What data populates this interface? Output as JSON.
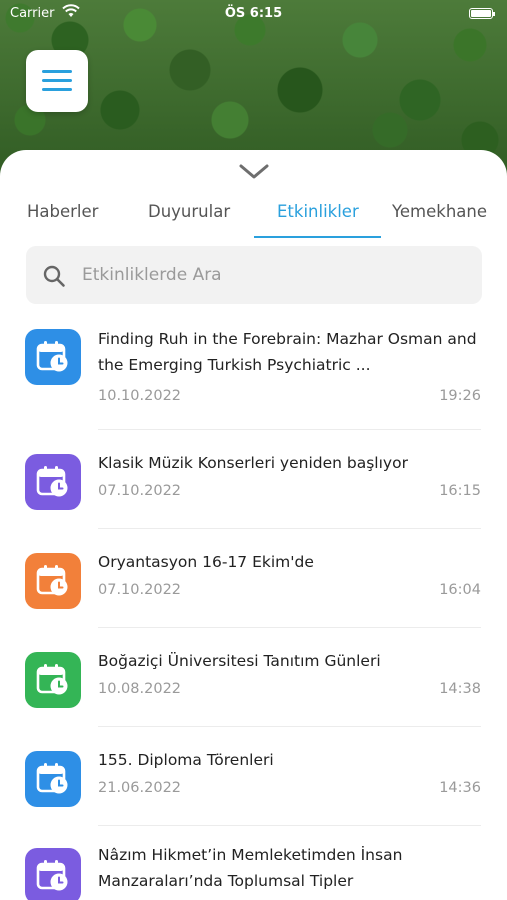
{
  "status_bar": {
    "carrier": "Carrier",
    "time": "ÖS 6:15"
  },
  "tabs": [
    {
      "label": "Haberler",
      "active": false
    },
    {
      "label": "Duyurular",
      "active": false
    },
    {
      "label": "Etkinlikler",
      "active": true
    },
    {
      "label": "Yemekhane",
      "active": false
    }
  ],
  "search": {
    "placeholder": "Etkinliklerde Ara",
    "value": ""
  },
  "events": [
    {
      "title": "Finding Ruh in the Forebrain: Mazhar Osman and the Emerging Turkish Psychiatric ...",
      "date": "10.10.2022",
      "time": "19:26",
      "icon": "calendar-clock-icon",
      "color": "#2e8fe6"
    },
    {
      "title": "Klasik Müzik Konserleri yeniden başlıyor",
      "date": "07.10.2022",
      "time": "16:15",
      "icon": "calendar-clock-icon",
      "color": "#7b5ce0"
    },
    {
      "title": "Oryantasyon 16-17 Ekim'de",
      "date": "07.10.2022",
      "time": "16:04",
      "icon": "calendar-clock-icon",
      "color": "#f2803a"
    },
    {
      "title": "Boğaziçi Üniversitesi Tanıtım Günleri",
      "date": "10.08.2022",
      "time": "14:38",
      "icon": "calendar-clock-icon",
      "color": "#34b556"
    },
    {
      "title": "155. Diploma Törenleri",
      "date": "21.06.2022",
      "time": "14:36",
      "icon": "calendar-clock-icon",
      "color": "#2e8fe6"
    },
    {
      "title": "Nâzım Hikmet’in Memleketimden İnsan Manzaraları’nda Toplumsal Tipler",
      "date": "",
      "time": "",
      "icon": "calendar-clock-icon",
      "color": "#7b5ce0"
    }
  ],
  "colors": {
    "accent": "#2aa0dd"
  }
}
